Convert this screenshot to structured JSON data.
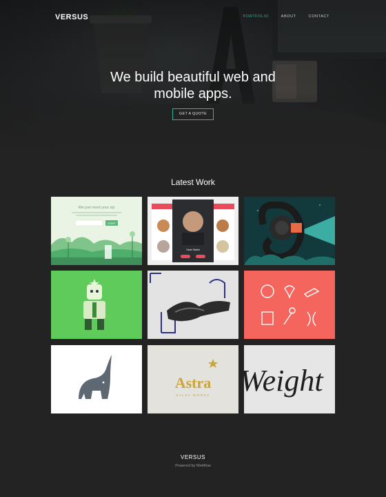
{
  "nav": {
    "brand": "VERSUS",
    "links": [
      {
        "label": "PORTFOLIO",
        "active": true
      },
      {
        "label": "ABOUT",
        "active": false
      },
      {
        "label": "CONTACT",
        "active": false
      }
    ]
  },
  "hero": {
    "title_line1": "We build beautiful web and",
    "title_line2": "mobile apps.",
    "cta_label": "GET A QUOTE"
  },
  "work": {
    "title": "Latest Work",
    "tiles": [
      {
        "name": "zip-landing",
        "text_heading": "We just need your zip",
        "text_button": "SUBMIT"
      },
      {
        "name": "chef-app",
        "text_person": "Gavin Stobel"
      },
      {
        "name": "tentacle-robot"
      },
      {
        "name": "robot-character"
      },
      {
        "name": "human-hands"
      },
      {
        "name": "icon-set"
      },
      {
        "name": "elephant-logo"
      },
      {
        "name": "astra-logo",
        "text_brand": "Astra",
        "text_sub": "SALSA WORKS"
      },
      {
        "name": "weight-lettering",
        "text_word": "Weight"
      }
    ]
  },
  "footer": {
    "brand": "VERSUS",
    "powered": "Powered by Webflow"
  },
  "colors": {
    "accent": "#2fb59c",
    "background": "#232323"
  }
}
